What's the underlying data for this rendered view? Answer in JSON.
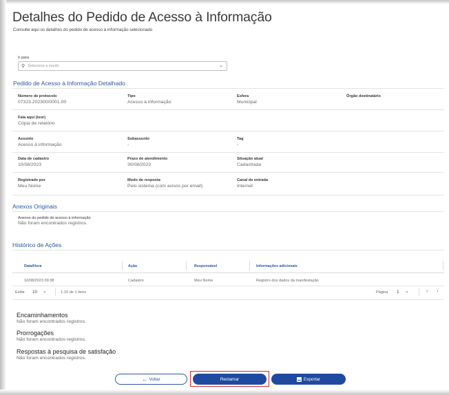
{
  "header": {
    "title": "Detalhes do Pedido de Acesso à Informação",
    "subtitle": "Consulte aqui os detalhes do pedido de acesso à informação selecionado"
  },
  "goto": {
    "label": "Ir para",
    "placeholder": "Selecione a seção"
  },
  "detail": {
    "section_title": "Pedido de Acesso à Informação Detalhado",
    "protocol_label": "Número de protocolo",
    "protocol_value": "07323.202300/0001-00",
    "type_label": "Tipo",
    "type_value": "Acesso à informação",
    "sphere_label": "Esfera",
    "sphere_value": "Municipal",
    "dest_label": "Órgão destinatário",
    "fala_label": "Fala aqui (teor)",
    "fala_value": "Cópia de relatório",
    "subject_label": "Assunto",
    "subject_value": "Acesso à informação",
    "subsubject_label": "Subassunto",
    "subsubject_value": "-",
    "tag_label": "Tag",
    "tag_value": "-",
    "created_label": "Data de cadastro",
    "created_value": "10/08/2023",
    "deadline_label": "Prazo de atendimento",
    "deadline_value": "30/08/2023",
    "status_label": "Situação atual",
    "status_value": "Cadastrada",
    "registered_label": "Registrado por",
    "registered_value": "Meu Nome",
    "response_label": "Modo de resposta",
    "response_value": "Pelo sistema (com avisos por email)",
    "channel_label": "Canal de entrada",
    "channel_value": "Internet"
  },
  "attachments": {
    "section_title": "Anexos Originais",
    "label": "Anexos do pedido de acesso à informação",
    "empty": "Não foram encontrados registros."
  },
  "history": {
    "section_title": "Histórico de Ações",
    "columns": [
      "Data/Hora",
      "Ação",
      "Responsável",
      "Informações adicionais"
    ],
    "rows": [
      [
        "10/08/2023 09:38",
        "Cadastro",
        "Meu Nome",
        "Registro dos dados da manifestação"
      ]
    ],
    "show_label": "Exibir",
    "per_page": "10",
    "range_text": "1-10 de 1 itens",
    "page_label": "Página",
    "page_value": "1"
  },
  "forwardings": {
    "title": "Encaminhamentos",
    "empty": "Não foram encontrados registros."
  },
  "extensions": {
    "title": "Prorrogações",
    "empty": "Não foram encontrados registros."
  },
  "survey": {
    "title": "Respostas à pesquisa de satisfação",
    "empty": "Não foram encontrados registros."
  },
  "actions": {
    "back_label": "Voltar",
    "complain_label": "Reclamar",
    "export_label": "Exportar"
  },
  "colors": {
    "accent": "#2a55a0",
    "primary_button": "#1f4aa0",
    "highlight": "#d0242b"
  }
}
